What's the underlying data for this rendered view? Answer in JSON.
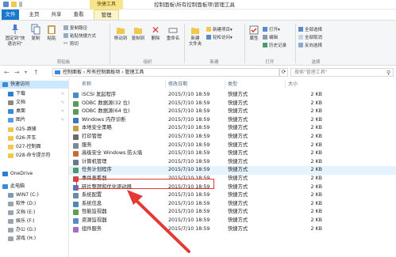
{
  "title_bar": {
    "context_tab": "快捷工具",
    "title": "控制面板\\所有控制面板项\\管理工具"
  },
  "ribbon_tabs": [
    "文件",
    "主页",
    "共享",
    "查看",
    "管理"
  ],
  "ribbon": {
    "pin_label": "固定到\"快\n速访问\"",
    "copy": "复制",
    "paste": "粘贴",
    "copy_path": "复制路径",
    "paste_shortcut": "粘贴快捷方式",
    "cut": "剪切",
    "clipboard_group": "剪贴板",
    "move_to": "移动到",
    "copy_to": "复制到",
    "delete": "删除",
    "rename": "重命名",
    "organize_group": "组织",
    "new_folder": "新建\n文件夹",
    "new_item": "新建项目▾",
    "easy_access": "轻松访问▾",
    "new_group": "新建",
    "properties": "属性",
    "open": "打开▾",
    "edit": "编辑",
    "history": "历史记录",
    "open_group": "打开",
    "select_all": "全部选择",
    "select_none": "全部取消",
    "invert_selection": "反向选择",
    "select_group": "选择"
  },
  "address_bar": {
    "path": "控制面板  ›  所有控制面板项  ›  管理工具",
    "search_placeholder": "搜索\"管理工具\""
  },
  "navigation": [
    {
      "label": "快速访问",
      "color": "#3a8ad8",
      "pinned": false,
      "selected": true
    },
    {
      "label": "下载",
      "color": "#2d7dd2",
      "pinned": true
    },
    {
      "label": "文档",
      "color": "#8a8a8a",
      "pinned": true
    },
    {
      "label": "桌面",
      "color": "#3a8ad8",
      "pinned": true
    },
    {
      "label": "图片",
      "color": "#5aa0e0",
      "pinned": true
    },
    {
      "label": "025-酒铺",
      "color": "#f0c850",
      "pinned": false
    },
    {
      "label": "026-开车",
      "color": "#f0c850",
      "pinned": false
    },
    {
      "label": "027-控制面",
      "color": "#f0c850",
      "pinned": false
    },
    {
      "label": "028-命令提示符",
      "color": "#f0c850",
      "pinned": false
    },
    {
      "label": "",
      "color": "#ffffff",
      "pinned": false
    },
    {
      "label": "OneDrive",
      "color": "#2d7dd2",
      "pinned": false
    },
    {
      "label": "此电脑",
      "color": "#3a8ad8",
      "pinned": false
    },
    {
      "label": "WIN7 (C:)",
      "color": "#7a9ab8",
      "pinned": false
    },
    {
      "label": "软件 (D:)",
      "color": "#9aa4ae",
      "pinned": false
    },
    {
      "label": "文档 (E:)",
      "color": "#9aa4ae",
      "pinned": false
    },
    {
      "label": "娱乐 (F:)",
      "color": "#9aa4ae",
      "pinned": false
    },
    {
      "label": "办公 (G:)",
      "color": "#9aa4ae",
      "pinned": false
    },
    {
      "label": "游戏 (H:)",
      "color": "#9aa4ae",
      "pinned": false
    }
  ],
  "columns": {
    "name": "名称",
    "date": "修改日期",
    "type": "类型",
    "size": "大小"
  },
  "files": [
    {
      "name": "iSCSI 发起程序",
      "date": "2015/7/10 18:59",
      "type": "快捷方式",
      "size": "2 KB",
      "color": "#4a8cc8"
    },
    {
      "name": "ODBC 数据源(32 位)",
      "date": "2015/7/10 18:59",
      "type": "快捷方式",
      "size": "2 KB",
      "color": "#5a9a5a"
    },
    {
      "name": "ODBC 数据源(64 位)",
      "date": "2015/7/10 18:59",
      "type": "快捷方式",
      "size": "2 KB",
      "color": "#5a9a5a"
    },
    {
      "name": "Windows 内存诊断",
      "date": "2015/7/10 18:59",
      "type": "快捷方式",
      "size": "2 KB",
      "color": "#3a7ab8"
    },
    {
      "name": "本地安全策略",
      "date": "2015/7/10 18:59",
      "type": "快捷方式",
      "size": "2 KB",
      "color": "#c8a040"
    },
    {
      "name": "打印管理",
      "date": "2015/7/10 18:59",
      "type": "快捷方式",
      "size": "2 KB",
      "color": "#6a6a6a"
    },
    {
      "name": "服务",
      "date": "2015/7/10 18:59",
      "type": "快捷方式",
      "size": "2 KB",
      "color": "#7a8a9a"
    },
    {
      "name": "高级安全 Windows 防火墙",
      "date": "2015/7/10 18:59",
      "type": "快捷方式",
      "size": "2 KB",
      "color": "#c86a3a"
    },
    {
      "name": "计算机管理",
      "date": "2015/7/10 18:59",
      "type": "快捷方式",
      "size": "2 KB",
      "color": "#6a7a8a"
    },
    {
      "name": "任务计划程序",
      "date": "2015/7/10 18:59",
      "type": "快捷方式",
      "size": "2 KB",
      "color": "#4a9a6a"
    },
    {
      "name": "事件查看器",
      "date": "2015/7/10 18:59",
      "type": "快捷方式",
      "size": "2 KB",
      "color": "#c84a4a"
    },
    {
      "name": "碎片整理和优化驱动器",
      "date": "2015/7/10 18:59",
      "type": "快捷方式",
      "size": "2 KB",
      "color": "#4a7ac8"
    },
    {
      "name": "系统配置",
      "date": "2015/7/10 18:59",
      "type": "快捷方式",
      "size": "2 KB",
      "color": "#6a8aa8"
    },
    {
      "name": "系统信息",
      "date": "2015/7/10 18:59",
      "type": "快捷方式",
      "size": "2 KB",
      "color": "#4a8ab8"
    },
    {
      "name": "性能监视器",
      "date": "2015/7/10 18:59",
      "type": "快捷方式",
      "size": "2 KB",
      "color": "#5aa05a"
    },
    {
      "name": "资源监视器",
      "date": "2015/7/10 18:59",
      "type": "快捷方式",
      "size": "2 KB",
      "color": "#5a8ac8"
    },
    {
      "name": "组件服务",
      "date": "2015/7/10 18:59",
      "type": "快捷方式",
      "size": "2 KB",
      "color": "#a86ac8"
    }
  ],
  "highlighted_index": 9,
  "accent_color": "#e53935"
}
